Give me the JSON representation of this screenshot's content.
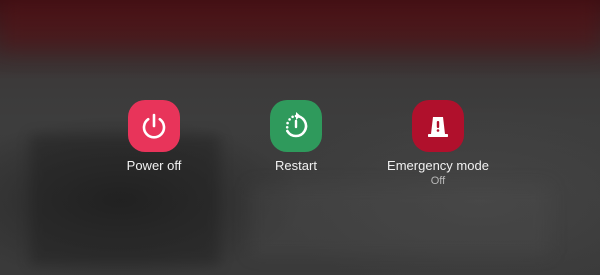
{
  "power_menu": {
    "options": [
      {
        "label": "Power off",
        "icon": "power-icon",
        "color": "#e8345a"
      },
      {
        "label": "Restart",
        "icon": "restart-icon",
        "color": "#2f9a5c"
      },
      {
        "label": "Emergency mode",
        "sublabel": "Off",
        "icon": "emergency-light-icon",
        "color": "#b0102c"
      }
    ]
  }
}
